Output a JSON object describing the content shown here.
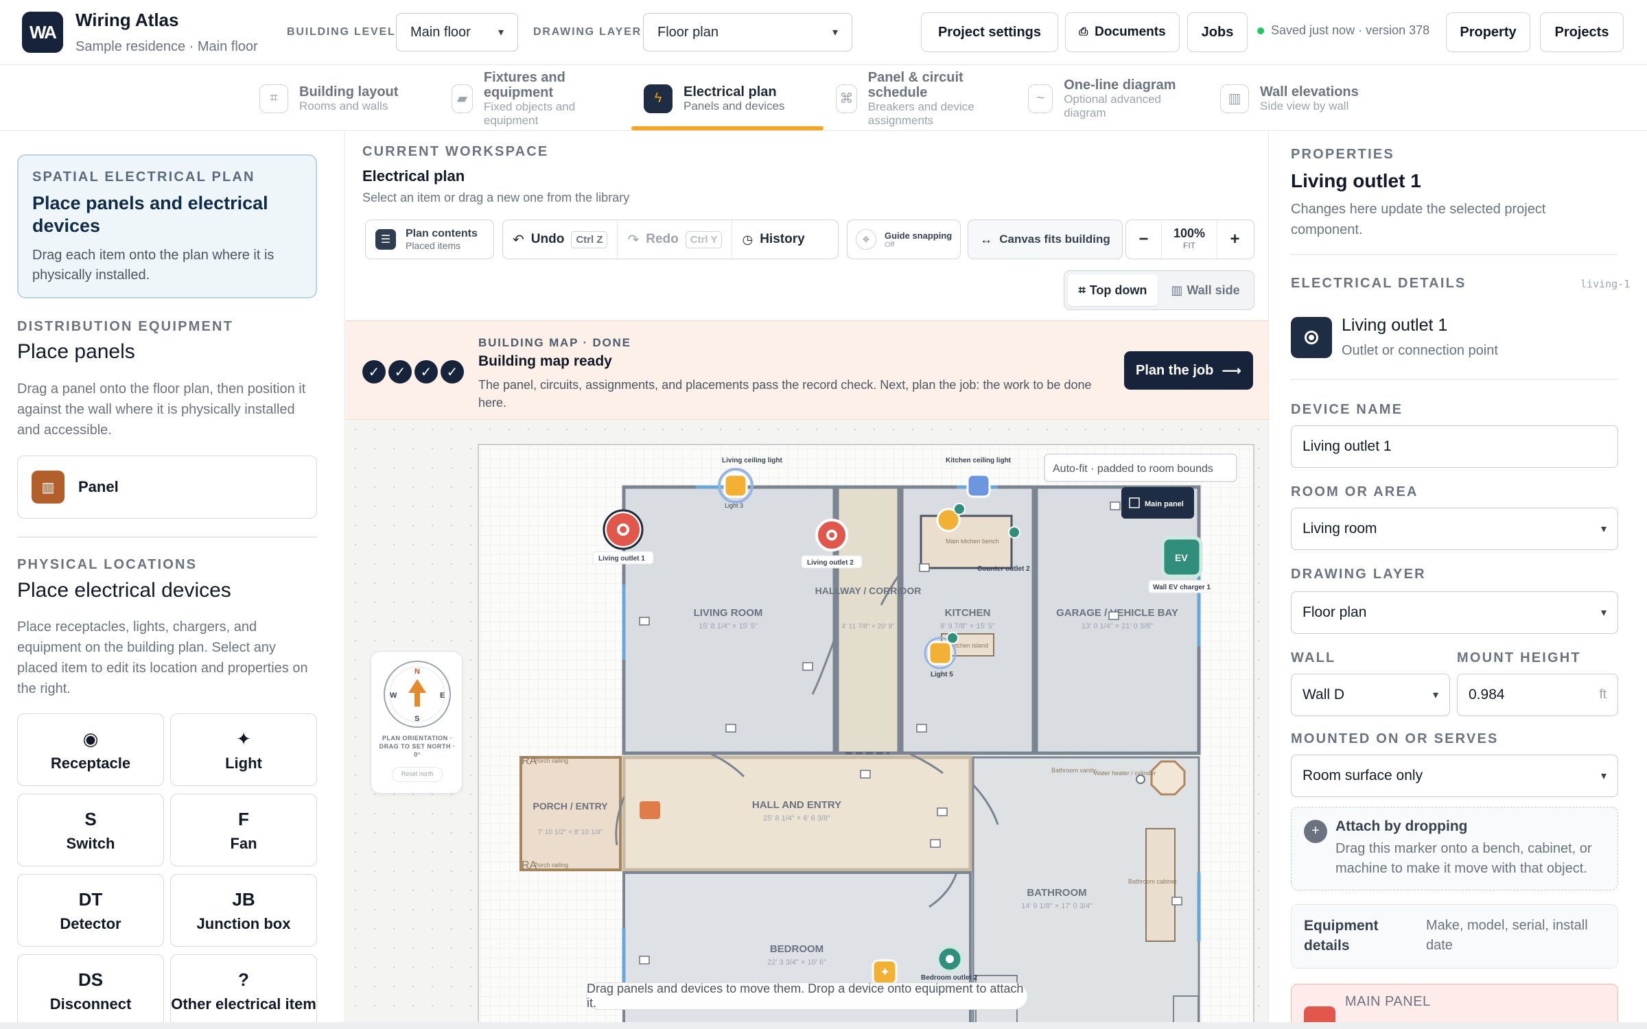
{
  "app": {
    "logo": "WA",
    "title": "Wiring Atlas",
    "subtitle": "Sample residence · Main floor"
  },
  "header": {
    "building_level_label": "BUILDING LEVEL",
    "building_level_value": "Main floor",
    "drawing_layer_label": "DRAWING LAYER",
    "drawing_layer_value": "Floor plan",
    "project_settings": "Project settings",
    "documents": "Documents",
    "jobs": "Jobs",
    "saved_status": "Saved just now · version 378",
    "property": "Property",
    "projects": "Projects"
  },
  "tabs": [
    {
      "title": "Building layout",
      "sub": "Rooms and walls"
    },
    {
      "title": "Fixtures and equipment",
      "sub": "Fixed objects and equipment"
    },
    {
      "title": "Electrical plan",
      "sub": "Panels and devices"
    },
    {
      "title": "Panel & circuit schedule",
      "sub": "Breakers and device assignments"
    },
    {
      "title": "One-line diagram",
      "sub": "Optional advanced diagram"
    },
    {
      "title": "Wall elevations",
      "sub": "Side view by wall"
    }
  ],
  "left": {
    "hero_kicker": "SPATIAL ELECTRICAL PLAN",
    "hero_title": "Place panels and electrical devices",
    "hero_text": "Drag each item onto the plan where it is physically installed.",
    "dist_kicker": "DISTRIBUTION EQUIPMENT",
    "dist_title": "Place panels",
    "dist_text": "Drag a panel onto the floor plan, then position it against the wall where it is physically installed and accessible.",
    "panel_label": "Panel",
    "phys_kicker": "PHYSICAL LOCATIONS",
    "phys_title": "Place electrical devices",
    "phys_text": "Place receptacles, lights, chargers, and equipment on the building plan. Select any placed item to edit its location and properties on the right.",
    "devices": [
      {
        "glyph": "◉",
        "name": "Receptacle"
      },
      {
        "glyph": "✦",
        "name": "Light"
      },
      {
        "glyph": "S",
        "name": "Switch"
      },
      {
        "glyph": "F",
        "name": "Fan"
      },
      {
        "glyph": "DT",
        "name": "Detector"
      },
      {
        "glyph": "JB",
        "name": "Junction box"
      },
      {
        "glyph": "DS",
        "name": "Disconnect"
      },
      {
        "glyph": "?",
        "name": "Other electrical item"
      }
    ]
  },
  "workspace": {
    "kicker": "CURRENT WORKSPACE",
    "title": "Electrical plan",
    "text": "Select an item or drag a new one from the library",
    "plan_contents": "Plan contents",
    "placed_items": "Placed items",
    "undo": "Undo",
    "undo_key": "Ctrl Z",
    "redo": "Redo",
    "redo_key": "Ctrl Y",
    "history": "History",
    "guide_snapping": "Guide snapping",
    "guide_state": "Off",
    "canvas_fits": "Canvas fits building",
    "zoom": "100%",
    "zoom_mode": "FIT",
    "minus": "−",
    "plus": "+",
    "top_down": "Top down",
    "wall_side": "Wall side"
  },
  "banner": {
    "kicker": "BUILDING MAP · DONE",
    "title": "Building map ready",
    "text": "The panel, circuits, assignments, and placements pass the record check. Next, plan the job: the work to be done here.",
    "button": "Plan the job"
  },
  "plan": {
    "autofit": "Auto-fit · padded to room bounds",
    "rooms": [
      {
        "name": "LIVING ROOM",
        "dims": "15' 8 1/4\" × 15' 5\""
      },
      {
        "name": "HALLWAY / CORRIDOR",
        "dims": "4' 11 7/8\" × 20' 8\""
      },
      {
        "name": "KITCHEN",
        "dims": "8' 9 7/8\" × 15' 5\""
      },
      {
        "name": "GARAGE / VEHICLE BAY",
        "dims": "13' 0 1/4\" × 21' 0 3/8\""
      },
      {
        "name": "PORCH / ENTRY",
        "dims": "7' 10 1/2\" × 8' 10 1/4\""
      },
      {
        "name": "HALL AND ENTRY",
        "dims": "25' 8 1/4\" × 6' 6 3/8\""
      },
      {
        "name": "BATHROOM",
        "dims": "14' 9 1/8\" × 17' 0 3/4\""
      },
      {
        "name": "BEDROOM",
        "dims": "22' 3 3/4\" × 10' 6\""
      }
    ],
    "labels": {
      "living_ceiling_light": "Living ceiling light",
      "kitchen_ceiling_light": "Kitchen ceiling light",
      "light3": "Light 3",
      "main_panel": "Main panel",
      "living_outlet_1": "Living outlet 1",
      "living_outlet_2": "Living outlet 2",
      "counter_outlet_2": "Counter outlet 2",
      "main_kitchen_bench": "Main kitchen bench",
      "wall_ev_charger": "Wall EV charger 1",
      "ev": "EV",
      "kitchen_island": "Kitchen island",
      "light5": "Light 5",
      "porch_railing_top": "Porch railing",
      "porch_railing_bottom": "Porch railing",
      "ra1": "RA",
      "ra2": "RA",
      "bathroom_vanity": "Bathroom vanity",
      "water_heater": "Water heater / cylinder",
      "bathroom_cabinet": "Bathroom cabinet",
      "bedroom_outlet_2": "Bedroom outlet 2"
    },
    "compass": {
      "n": "N",
      "e": "E",
      "s": "S",
      "w": "W",
      "text": "PLAN ORIENTATION · DRAG TO SET NORTH · 0°",
      "reset": "Reset north"
    },
    "hint": "Drag panels and devices to move them. Drop a device onto equipment to attach it."
  },
  "properties": {
    "kicker": "PROPERTIES",
    "title": "Living outlet 1",
    "text": "Changes here update the selected project component.",
    "elec_kicker": "ELECTRICAL DETAILS",
    "elec_id": "living-1",
    "device_title": "Living outlet 1",
    "device_sub": "Outlet or connection point",
    "device_name_label": "DEVICE NAME",
    "device_name_value": "Living outlet 1",
    "room_label": "ROOM OR AREA",
    "room_value": "Living room",
    "layer_label": "DRAWING LAYER",
    "layer_value": "Floor plan",
    "wall_label": "WALL",
    "wall_value": "Wall D",
    "mount_label": "MOUNT HEIGHT",
    "mount_value": "0.984",
    "mount_unit": "ft",
    "serves_label": "MOUNTED ON OR SERVES",
    "serves_value": "Room surface only",
    "attach_title": "Attach by dropping",
    "attach_text": "Drag this marker onto a bench, cabinet, or machine to make it move with that object.",
    "equip_title": "Equipment details",
    "equip_text": "Make, model, serial, install date",
    "main_panel_label": "MAIN PANEL"
  },
  "colors": {
    "navy": "#16233b",
    "accent": "#f5a623",
    "outlet": "#e2574c",
    "light": "#f2b134",
    "ev": "#2f8f7c"
  }
}
